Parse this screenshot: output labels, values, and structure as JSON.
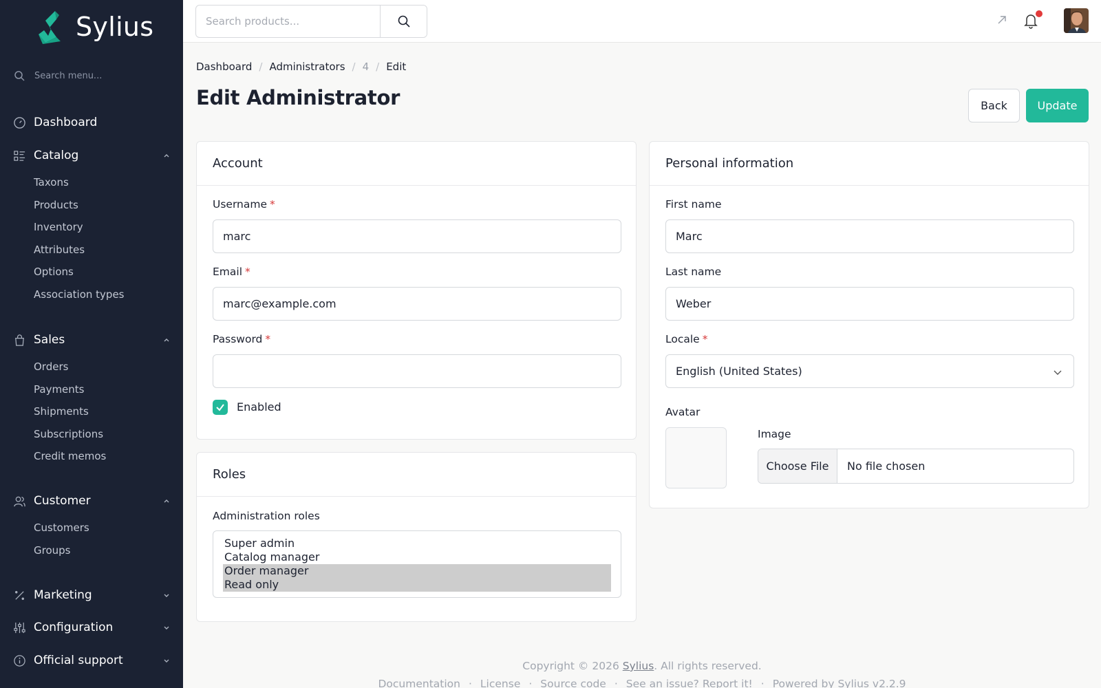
{
  "app": {
    "brand_name": "Sylius",
    "accent_color": "#22b99a",
    "sidebar_bg": "#1b2233"
  },
  "sidebar": {
    "search_placeholder": "Search menu...",
    "dashboard": {
      "label": "Dashboard",
      "icon": "gauge-icon"
    },
    "catalog": {
      "label": "Catalog",
      "icon": "catalog-icon",
      "expanded": true,
      "items": [
        "Taxons",
        "Products",
        "Inventory",
        "Attributes",
        "Options",
        "Association types"
      ]
    },
    "sales": {
      "label": "Sales",
      "icon": "shopping-bag-icon",
      "expanded": true,
      "items": [
        "Orders",
        "Payments",
        "Shipments",
        "Subscriptions",
        "Credit memos"
      ]
    },
    "customer": {
      "label": "Customer",
      "icon": "users-icon",
      "expanded": true,
      "items": [
        "Customers",
        "Groups"
      ]
    },
    "marketing": {
      "label": "Marketing",
      "icon": "percent-icon",
      "expanded": false
    },
    "configuration": {
      "label": "Configuration",
      "icon": "sliders-icon",
      "expanded": false
    },
    "support": {
      "label": "Official support",
      "icon": "info-icon",
      "expanded": false
    }
  },
  "topbar": {
    "search_placeholder": "Search products..."
  },
  "breadcrumb": {
    "dashboard": "Dashboard",
    "administrators": "Administrators",
    "id": "4",
    "current": "Edit"
  },
  "page": {
    "title": "Edit Administrator",
    "back_label": "Back",
    "update_label": "Update"
  },
  "account": {
    "title": "Account",
    "username_label": "Username",
    "username_value": "marc",
    "email_label": "Email",
    "email_value": "marc@example.com",
    "password_label": "Password",
    "password_value": "",
    "enabled_label": "Enabled",
    "enabled_checked": true,
    "required_mark": "*"
  },
  "roles": {
    "title": "Roles",
    "label": "Administration roles",
    "options": [
      {
        "label": "Super admin",
        "selected": false
      },
      {
        "label": "Catalog manager",
        "selected": false
      },
      {
        "label": "Order manager",
        "selected": true
      },
      {
        "label": "Read only",
        "selected": true
      }
    ]
  },
  "personal": {
    "title": "Personal information",
    "first_name_label": "First name",
    "first_name_value": "Marc",
    "last_name_label": "Last name",
    "last_name_value": "Weber",
    "locale_label": "Locale",
    "locale_value": "English (United States)",
    "avatar_label": "Avatar",
    "image_label": "Image",
    "choose_file_label": "Choose File",
    "no_file_label": "No file chosen"
  },
  "footer": {
    "copyright_prefix": "Copyright © 2026",
    "copyright_link": "Sylius",
    "copyright_suffix": ". All rights reserved.",
    "links": [
      "Documentation",
      "License",
      "Source code",
      "See an issue? Report it!",
      "Powered by Sylius v2.2.9"
    ],
    "separator": "·"
  }
}
